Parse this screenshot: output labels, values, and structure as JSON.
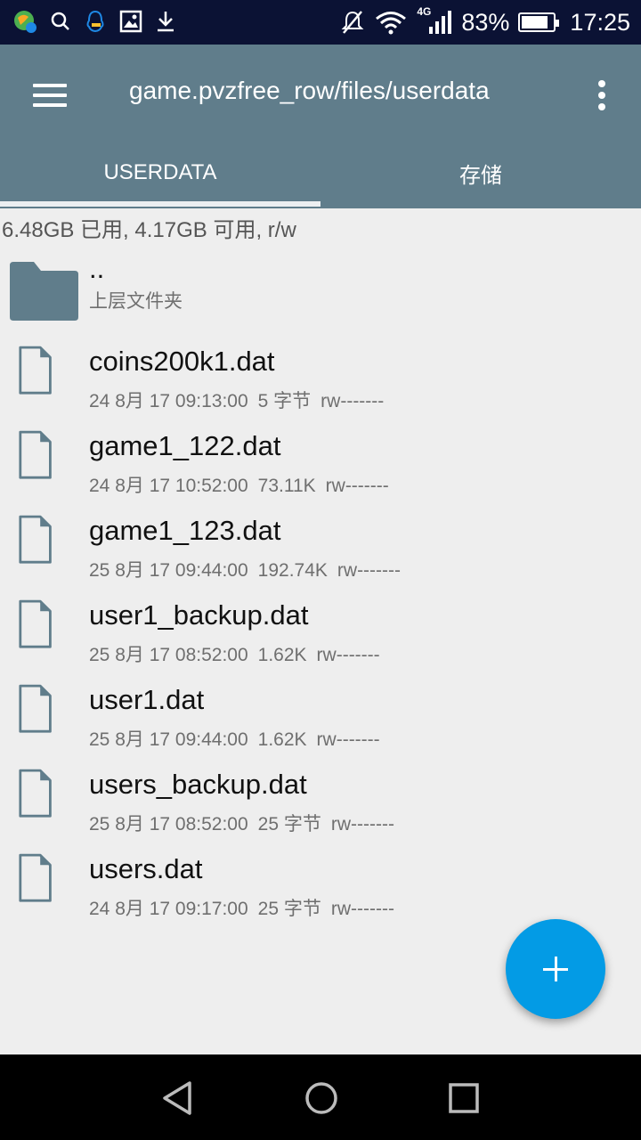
{
  "status_bar": {
    "network_badge": "4G",
    "battery_percent": "83%",
    "battery_level": 0.83,
    "time": "17:25",
    "left_icons": [
      "app-globe-icon",
      "search-icon",
      "qq-icon",
      "image-icon",
      "download-icon"
    ],
    "right_icons": [
      "mute-icon",
      "wifi-icon",
      "signal-icon",
      "battery-icon"
    ]
  },
  "app_bar": {
    "title": "game.pvzfree_row/files/userdata",
    "menu_icon": "hamburger-menu-icon",
    "overflow_icon": "more-vert-icon",
    "color": "#607d8b"
  },
  "tabs": [
    {
      "label": "USERDATA",
      "active": true
    },
    {
      "label": "存储",
      "active": false
    }
  ],
  "storage_info": "6.48GB 已用, 4.17GB 可用, r/w",
  "parent_folder": {
    "name": "..",
    "subtitle": "上层文件夹",
    "icon": "folder-icon"
  },
  "files": [
    {
      "name": "coins200k1.dat",
      "date": "24 8月 17 09:13:00",
      "size": "5 字节",
      "perms": "rw-------"
    },
    {
      "name": "game1_122.dat",
      "date": "24 8月 17 10:52:00",
      "size": "73.11K",
      "perms": "rw-------"
    },
    {
      "name": "game1_123.dat",
      "date": "25 8月 17 09:44:00",
      "size": "192.74K",
      "perms": "rw-------"
    },
    {
      "name": "user1_backup.dat",
      "date": "25 8月 17 08:52:00",
      "size": "1.62K",
      "perms": "rw-------"
    },
    {
      "name": "user1.dat",
      "date": "25 8月 17 09:44:00",
      "size": "1.62K",
      "perms": "rw-------"
    },
    {
      "name": "users_backup.dat",
      "date": "25 8月 17 08:52:00",
      "size": "25 字节",
      "perms": "rw-------"
    },
    {
      "name": "users.dat",
      "date": "24 8月 17 09:17:00",
      "size": "25 字节",
      "perms": "rw-------"
    }
  ],
  "fab": {
    "icon": "add-icon",
    "color": "#039be5"
  },
  "nav_bar": {
    "icons": [
      "back-icon",
      "home-icon",
      "recents-icon"
    ]
  }
}
